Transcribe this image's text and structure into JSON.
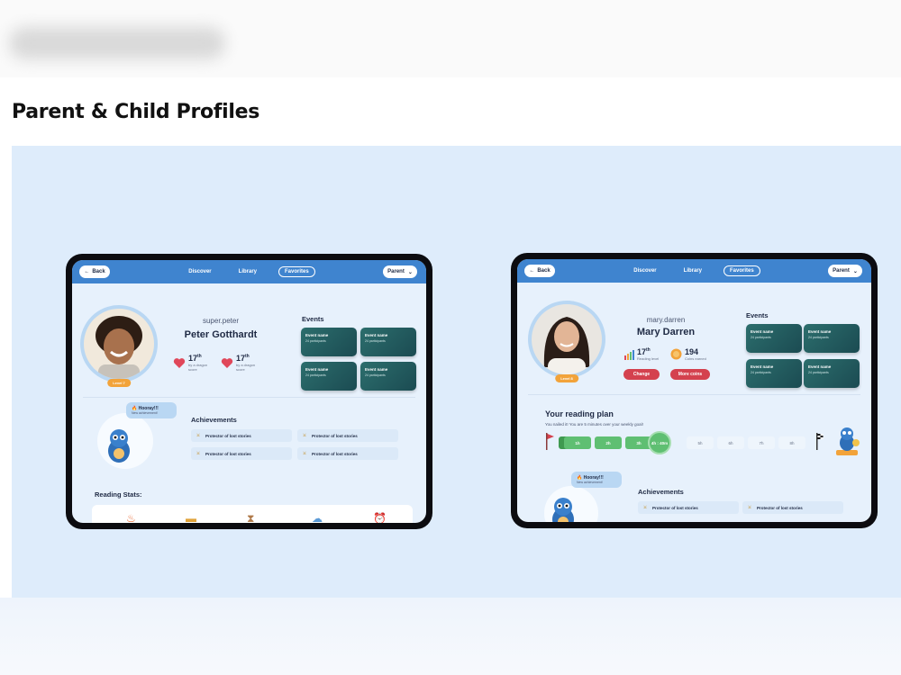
{
  "page": {
    "section_title": "Parent & Child Profiles"
  },
  "left_tablet": {
    "nav": {
      "back": "Back",
      "links": [
        "Discover",
        "Library",
        "Favorites"
      ],
      "active": "Favorites",
      "parent": "Parent"
    },
    "profile": {
      "username": "super.peter",
      "name": "Peter Gotthardt",
      "level": "Level 7",
      "stats": [
        {
          "value": "17",
          "suffix": "th",
          "label": "by a dragon score"
        },
        {
          "value": "17",
          "suffix": "th",
          "label": "by a dragon score"
        }
      ]
    },
    "events": {
      "heading": "Events",
      "items": [
        {
          "name": "Event name",
          "participants": "24 participants"
        },
        {
          "name": "Event name",
          "participants": "24 participants"
        },
        {
          "name": "Event name",
          "participants": "24 participants"
        },
        {
          "name": "Event name",
          "participants": "24 participants"
        }
      ]
    },
    "bubble": {
      "title": "Hooray!!!",
      "subtitle": "New achievement!"
    },
    "achievements": {
      "heading": "Achievements",
      "items": [
        "Protector of lost stories",
        "Protector of lost stories",
        "Protector of lost stories",
        "Protector of lost stories"
      ]
    },
    "reading_stats": {
      "heading": "Reading Stats:"
    }
  },
  "right_tablet": {
    "nav": {
      "back": "Back",
      "links": [
        "Discover",
        "Library",
        "Favorites"
      ],
      "active": "Favorites",
      "parent": "Parent"
    },
    "profile": {
      "username": "mary.darren",
      "name": "Mary Darren",
      "level": "Level 8",
      "stats": [
        {
          "value": "17",
          "suffix": "th",
          "label": "Reading level"
        },
        {
          "value": "194",
          "suffix": "",
          "label": "Coins earned"
        }
      ],
      "buttons": {
        "change": "Change",
        "more_coins": "More coins"
      }
    },
    "events": {
      "heading": "Events",
      "items": [
        {
          "name": "Event name",
          "participants": "24 participants"
        },
        {
          "name": "Event name",
          "participants": "24 participants"
        },
        {
          "name": "Event name",
          "participants": "24 participants"
        },
        {
          "name": "Event name",
          "participants": "24 participants"
        }
      ]
    },
    "reading_plan": {
      "heading": "Your reading plan",
      "subtitle": "You nailed it! You are 5 minutes over your weekly goal!",
      "segments": [
        "1h",
        "2h",
        "3h",
        "5h",
        "6h",
        "7h",
        "8h"
      ],
      "current": "4h : 40m"
    },
    "bubble": {
      "title": "Hooray!!!",
      "subtitle": "New achievement!"
    },
    "achievements": {
      "heading": "Achievements",
      "items": [
        "Protector of lost stories",
        "Protector of lost stories"
      ]
    }
  },
  "colors": {
    "stage": "#deecfb",
    "nav": "#3f84cf",
    "progress": "#5fbf72",
    "accent": "#d4414e",
    "level": "#f2a33a"
  }
}
